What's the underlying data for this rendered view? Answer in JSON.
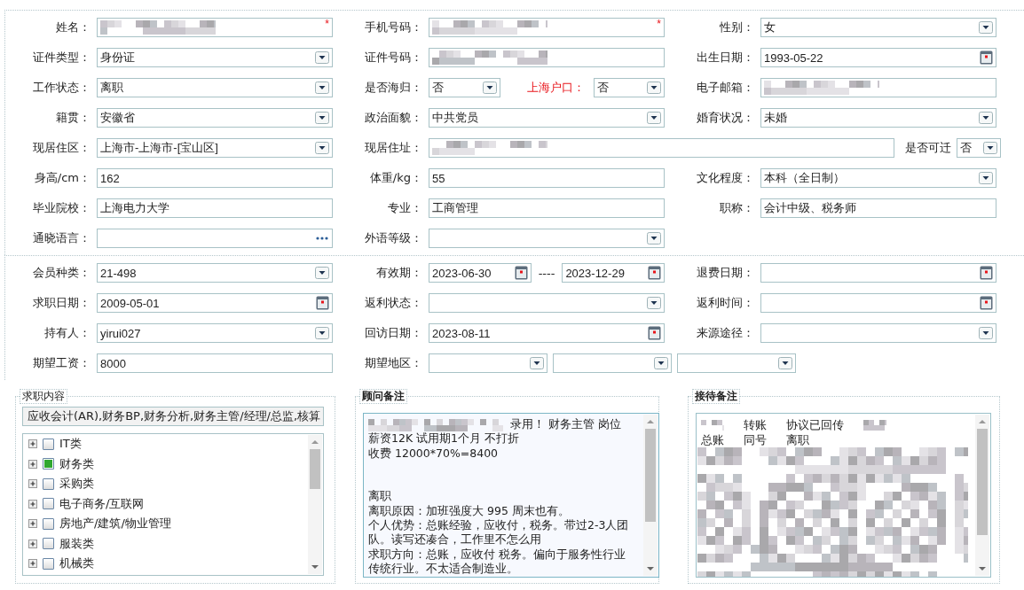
{
  "sections": [
    {
      "rows": [
        {
          "cells": [
            {
              "label": "姓名：",
              "fields": [
                {
                  "kind": "text",
                  "redacted": true,
                  "required_mark": "*"
                }
              ]
            },
            {
              "label": "手机号码：",
              "fields": [
                {
                  "kind": "text",
                  "redacted": true,
                  "required_mark": "*"
                }
              ]
            },
            {
              "label": "性别：",
              "fields": [
                {
                  "kind": "select",
                  "value": "女"
                }
              ]
            }
          ]
        },
        {
          "cells": [
            {
              "label": "证件类型：",
              "fields": [
                {
                  "kind": "select",
                  "value": "身份证"
                }
              ]
            },
            {
              "label": "证件号码：",
              "fields": [
                {
                  "kind": "text",
                  "redacted": true
                }
              ]
            },
            {
              "label": "出生日期：",
              "fields": [
                {
                  "kind": "date",
                  "value": "1993-05-22"
                }
              ]
            }
          ]
        },
        {
          "cells": [
            {
              "label": "工作状态：",
              "fields": [
                {
                  "kind": "select",
                  "value": "离职"
                }
              ]
            },
            {
              "label": "是否海归：",
              "fields": [
                {
                  "kind": "select",
                  "value": "否"
                },
                {
                  "kind": "label",
                  "text": "上海户口：",
                  "highlight": true
                },
                {
                  "kind": "select",
                  "value": "否"
                }
              ]
            },
            {
              "label": "电子邮箱：",
              "fields": [
                {
                  "kind": "text",
                  "redacted": true
                }
              ]
            }
          ]
        },
        {
          "cells": [
            {
              "label": "籍贯：",
              "fields": [
                {
                  "kind": "select",
                  "value": "安徽省"
                }
              ]
            },
            {
              "label": "政治面貌：",
              "fields": [
                {
                  "kind": "select",
                  "value": "中共党员"
                }
              ]
            },
            {
              "label": "婚育状况：",
              "fields": [
                {
                  "kind": "select",
                  "value": "未婚"
                }
              ]
            }
          ]
        },
        {
          "cells": [
            {
              "label": "现居住区：",
              "fields": [
                {
                  "kind": "select",
                  "value": " 上海市-上海市-[宝山区]"
                }
              ]
            },
            {
              "label": "现居住址：",
              "fields": [
                {
                  "kind": "text",
                  "redacted": true
                },
                {
                  "kind": "label",
                  "text": "是否可迁",
                  "highlight": false
                },
                {
                  "kind": "mini-select",
                  "value": "否"
                }
              ]
            }
          ]
        },
        {
          "cells": [
            {
              "label": "身高/cm：",
              "fields": [
                {
                  "kind": "text",
                  "value": "162"
                }
              ]
            },
            {
              "label": "体重/kg：",
              "fields": [
                {
                  "kind": "text",
                  "value": "55"
                }
              ]
            },
            {
              "label": "文化程度：",
              "fields": [
                {
                  "kind": "select",
                  "value": "本科（全日制）"
                }
              ]
            }
          ]
        },
        {
          "cells": [
            {
              "label": "毕业院校：",
              "fields": [
                {
                  "kind": "text",
                  "value": "上海电力大学"
                }
              ]
            },
            {
              "label": "专业：",
              "fields": [
                {
                  "kind": "text",
                  "value": "工商管理"
                }
              ]
            },
            {
              "label": "职称：",
              "fields": [
                {
                  "kind": "text",
                  "value": "会计中级、税务师"
                }
              ]
            }
          ]
        },
        {
          "cells": [
            {
              "label": "通晓语言：",
              "fields": [
                {
                  "kind": "picker"
                }
              ]
            },
            {
              "label": "外语等级：",
              "fields": [
                {
                  "kind": "select"
                }
              ]
            }
          ]
        }
      ]
    },
    {
      "rows": [
        {
          "cells": [
            {
              "label": "会员种类：",
              "fields": [
                {
                  "kind": "select",
                  "value": " 21-498"
                }
              ]
            },
            {
              "label": "有效期：",
              "fields": [
                {
                  "kind": "date",
                  "value": "2023-06-30"
                },
                {
                  "kind": "dash",
                  "text": "----"
                },
                {
                  "kind": "date",
                  "value": "2023-12-29"
                }
              ]
            },
            {
              "label": "退费日期：",
              "fields": [
                {
                  "kind": "date"
                }
              ]
            }
          ]
        },
        {
          "cells": [
            {
              "label": "求职日期：",
              "fields": [
                {
                  "kind": "date",
                  "value": "2009-05-01"
                }
              ]
            },
            {
              "label": "返利状态：",
              "fields": [
                {
                  "kind": "select"
                }
              ]
            },
            {
              "label": "返利时间：",
              "fields": [
                {
                  "kind": "date"
                }
              ]
            }
          ]
        },
        {
          "cells": [
            {
              "label": "持有人：",
              "fields": [
                {
                  "kind": "select",
                  "value": "yirui027"
                }
              ]
            },
            {
              "label": "回访日期：",
              "fields": [
                {
                  "kind": "date",
                  "value": "2023-08-11"
                }
              ]
            },
            {
              "label": "来源途径：",
              "fields": [
                {
                  "kind": "select"
                }
              ]
            }
          ]
        },
        {
          "cells": [
            {
              "label": "期望工资：",
              "fields": [
                {
                  "kind": "text",
                  "value": "8000"
                }
              ]
            },
            {
              "label": "期望地区：",
              "fields": [
                {
                  "kind": "region-select"
                },
                {
                  "kind": "region-select"
                },
                {
                  "kind": "region-select"
                }
              ]
            }
          ]
        }
      ]
    }
  ],
  "job_panel": {
    "title": "求职内容",
    "summary": "应收会计(AR),财务BP,财务分析,财务主管/经理/总监,核算",
    "tree": [
      {
        "label": "IT类",
        "checked": false,
        "expanded": false
      },
      {
        "label": "财务类",
        "checked": true,
        "expanded": false
      },
      {
        "label": "采购类",
        "checked": false,
        "expanded": false
      },
      {
        "label": "电子商务/互联网",
        "checked": false,
        "expanded": false
      },
      {
        "label": "房地产/建筑/物业管理",
        "checked": false,
        "expanded": false
      },
      {
        "label": "服装类",
        "checked": false,
        "expanded": false
      },
      {
        "label": "机械类",
        "checked": false,
        "expanded": false
      }
    ]
  },
  "advisor_notes": {
    "title": "顾问备注",
    "lines": [
      {
        "text": "录用！ 财务主管 岗位",
        "redacted_prefix": true,
        "space_before": false
      },
      {
        "text": "薪资12K 试用期1个月 不打折",
        "redacted_prefix": false,
        "space_before": false
      },
      {
        "text": "收费 12000*70%=8400",
        "redacted_prefix": false,
        "space_before": false
      },
      {
        "text": "离职",
        "redacted_prefix": false,
        "space_before": true
      },
      {
        "text": "离职原因：加班强度大 995 周末也有。",
        "redacted_prefix": false,
        "space_before": false
      },
      {
        "text": "个人优势：总账经验，应收付，税务。带过2-3人团",
        "redacted_prefix": false,
        "space_before": false
      },
      {
        "text": "队。读写还凑合，工作里不怎么用",
        "redacted_prefix": false,
        "space_before": false
      },
      {
        "text": "求职方向：总账，应收付 税务。偏向于服务性行业",
        "redacted_prefix": false,
        "space_before": false
      },
      {
        "text": "传统行业。不太适合制造业。",
        "redacted_prefix": false,
        "space_before": false
      }
    ]
  },
  "reception_notes": {
    "title": "接待备注",
    "lines": [
      {
        "words": [
          {
            "redacted": true
          },
          {
            "text": "转账"
          },
          {
            "text": "协议已回传"
          },
          {
            "redacted": true
          }
        ]
      },
      {
        "words": [
          {
            "text": "总账"
          },
          {
            "text": "同号"
          },
          {
            "text": "离职"
          }
        ]
      }
    ],
    "redacted_block": true
  }
}
